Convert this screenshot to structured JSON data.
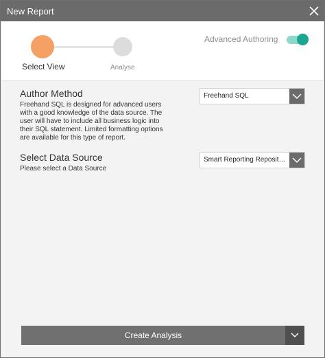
{
  "dialog": {
    "title": "New Report",
    "close_icon": "close-icon"
  },
  "stepper": {
    "steps": [
      {
        "label": "Select View",
        "state": "active",
        "color": "#f5a064"
      },
      {
        "label": "Analyse",
        "state": "inactive",
        "color": "#dcdcdc"
      }
    ]
  },
  "advanced_authoring": {
    "label": "Advanced Authoring",
    "enabled": true,
    "accent_color": "#1aa68f"
  },
  "author_method": {
    "title": "Author Method",
    "description": "Freehand SQL is designed for advanced users with a good knowledge of the data source. The user will have to include all business logic into their SQL statement. Limited formatting options are available for this type of report.",
    "selected": "Freehand SQL",
    "dropdown_icon": "chevron-down-icon"
  },
  "data_source": {
    "title": "Select Data Source",
    "description": "Please select a Data Source",
    "selected": "Smart Reporting Repository",
    "dropdown_icon": "chevron-down-icon"
  },
  "footer": {
    "create_label": "Create Analysis",
    "dropdown_icon": "chevron-down-icon"
  }
}
